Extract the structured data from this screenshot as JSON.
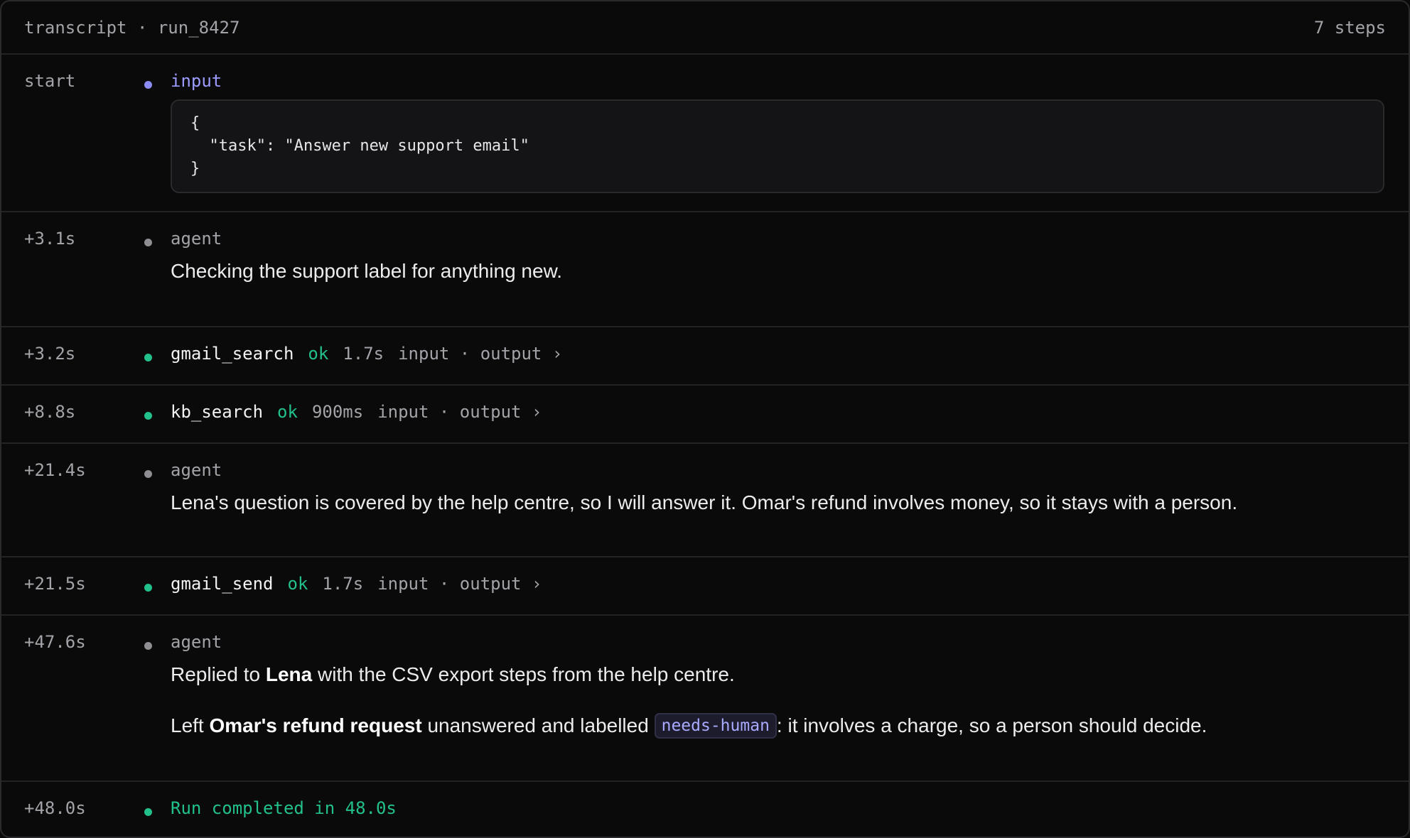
{
  "header": {
    "title": "transcript · run_8427",
    "steps": "7 steps"
  },
  "colors": {
    "input_accent": "#9c9cff",
    "ok": "#22c08a",
    "muted": "#a3a3a8",
    "background": "#0a0a0b"
  },
  "rows": {
    "r0": {
      "time": "start",
      "kind": "input",
      "code": "{\n  \"task\": \"Answer new support email\"\n}"
    },
    "r1": {
      "time": "+3.1s",
      "kind": "agent",
      "text": "Checking the support label for anything new."
    },
    "r2": {
      "time": "+3.2s",
      "tool": "gmail_search",
      "status": "ok",
      "duration": "1.7s",
      "io": "input · output ›"
    },
    "r3": {
      "time": "+8.8s",
      "tool": "kb_search",
      "status": "ok",
      "duration": "900ms",
      "io": "input · output ›"
    },
    "r4": {
      "time": "+21.4s",
      "kind": "agent",
      "text": "Lena's question is covered by the help centre, so I will answer it. Omar's refund involves money, so it stays with a person."
    },
    "r5": {
      "time": "+21.5s",
      "tool": "gmail_send",
      "status": "ok",
      "duration": "1.7s",
      "io": "input · output ›"
    },
    "r6": {
      "time": "+47.6s",
      "kind": "agent",
      "p1_pre": "Replied to ",
      "p1_bold": "Lena",
      "p1_post": " with the CSV export steps from the help centre.",
      "p2_pre": "Left ",
      "p2_bold": "Omar's refund request",
      "p2_mid": " unanswered and labelled ",
      "p2_tag": "needs-human",
      "p2_post": ": it involves a charge, so a person should decide."
    },
    "r7": {
      "time": "+48.0s",
      "text": "Run completed in 48.0s"
    }
  }
}
